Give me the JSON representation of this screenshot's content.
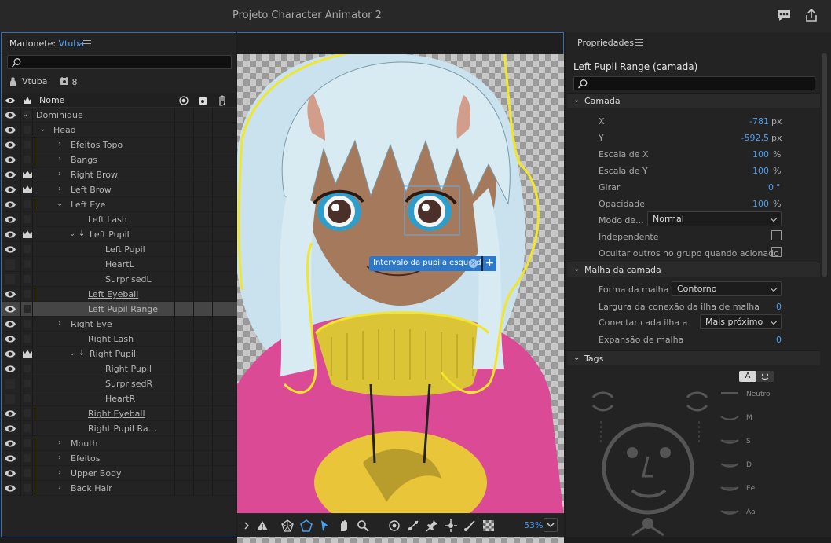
{
  "app": {
    "title": "Projeto Character Animator 2"
  },
  "left_panel": {
    "header_prefix": "Marionete:",
    "header_name": "Vtuba",
    "puppet_name": "Vtuba",
    "puppet_count": "8",
    "column_name": "Nome",
    "rows": [
      {
        "label": "Dominique",
        "eye": true,
        "crown": false,
        "yellow": false
      },
      {
        "label": "Head",
        "eye": true,
        "crown": false,
        "yellow": false
      },
      {
        "label": "Efeitos Topo",
        "eye": true,
        "crown": false,
        "yellow": true
      },
      {
        "label": "Bangs",
        "eye": true,
        "crown": false,
        "yellow": true
      },
      {
        "label": "Right Brow",
        "eye": true,
        "crown": true,
        "yellow": false
      },
      {
        "label": "Left Brow",
        "eye": true,
        "crown": true,
        "yellow": false
      },
      {
        "label": "Left Eye",
        "eye": true,
        "crown": false,
        "yellow": true
      },
      {
        "label": "Left Lash",
        "eye": true,
        "crown": false,
        "yellow": false
      },
      {
        "label": "Left Pupil",
        "eye": true,
        "crown": true,
        "yellow": false
      },
      {
        "label": "Left Pupil",
        "eye": true,
        "crown": false,
        "yellow": false
      },
      {
        "label": "HeartL",
        "eye": false,
        "crown": false,
        "yellow": false
      },
      {
        "label": "SurprisedL",
        "eye": false,
        "crown": false,
        "yellow": false
      },
      {
        "label": "Left Eyeball",
        "eye": true,
        "crown": false,
        "yellow": true
      },
      {
        "label": "Left Pupil Range",
        "eye": true,
        "crown": false,
        "yellow": false
      },
      {
        "label": "Right Eye",
        "eye": true,
        "crown": false,
        "yellow": false
      },
      {
        "label": "Right Lash",
        "eye": true,
        "crown": false,
        "yellow": false
      },
      {
        "label": "Right Pupil",
        "eye": true,
        "crown": true,
        "yellow": false
      },
      {
        "label": "Right Pupil",
        "eye": true,
        "crown": false,
        "yellow": false
      },
      {
        "label": "SurprisedR",
        "eye": false,
        "crown": false,
        "yellow": false
      },
      {
        "label": "HeartR",
        "eye": false,
        "crown": false,
        "yellow": false
      },
      {
        "label": "Right Eyeball",
        "eye": true,
        "crown": false,
        "yellow": true
      },
      {
        "label": "Right Pupil Ra...",
        "eye": true,
        "crown": false,
        "yellow": false
      },
      {
        "label": "Mouth",
        "eye": true,
        "crown": false,
        "yellow": true
      },
      {
        "label": "Efeitos",
        "eye": true,
        "crown": false,
        "yellow": true
      },
      {
        "label": "Upper Body",
        "eye": true,
        "crown": false,
        "yellow": true
      },
      {
        "label": "Back Hair",
        "eye": true,
        "crown": false,
        "yellow": true
      }
    ]
  },
  "canvas": {
    "tag_label": "Intervalo da pupila esquerda",
    "zoom": "53%"
  },
  "right_panel": {
    "title": "Propriedades",
    "layer_title": "Left Pupil Range (camada)",
    "section_layer": "Camada",
    "x_label": "X",
    "x_value": "-781",
    "x_unit": "px",
    "y_label": "Y",
    "y_value": "-592,5",
    "y_unit": "px",
    "scalex_label": "Escala de X",
    "scalex_value": "100",
    "scalex_unit": "%",
    "scaley_label": "Escala de Y",
    "scaley_value": "100",
    "scaley_unit": "%",
    "rotate_label": "Girar",
    "rotate_value": "0",
    "rotate_unit": "°",
    "opacity_label": "Opacidade",
    "opacity_value": "100",
    "opacity_unit": "%",
    "mode_label": "Modo de...",
    "mode_value": "Normal",
    "independent_label": "Independente",
    "hide_label": "Ocultar outros no grupo quando acionado",
    "section_mesh": "Malha da camada",
    "mesh_shape_label": "Forma da malha",
    "mesh_shape_value": "Contorno",
    "mesh_island_label": "Largura da conexão da ilha de malha",
    "mesh_island_value": "0",
    "connect_label": "Conectar cada ilha a",
    "connect_value": "Mais próximo",
    "expansion_label": "Expansão de malha",
    "expansion_value": "0",
    "section_tags": "Tags",
    "tag_toggle_a": "A",
    "visemes": [
      "Neutro",
      "M",
      "S",
      "D",
      "Ee",
      "Aa"
    ]
  }
}
